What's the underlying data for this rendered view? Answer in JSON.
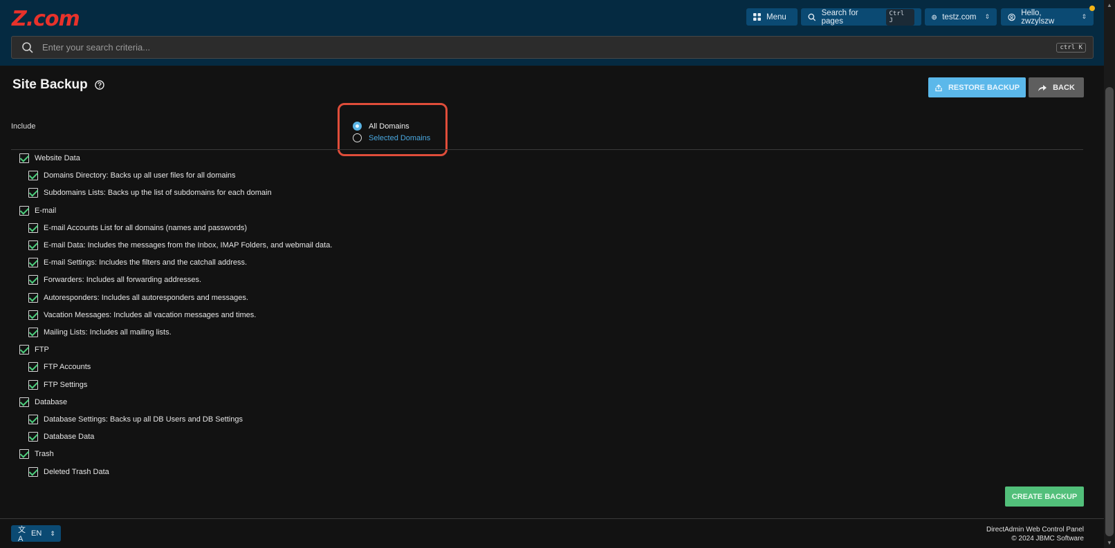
{
  "header": {
    "logo": "Z.com",
    "menu_label": "Menu",
    "search_pages_label": "Search for pages",
    "search_pages_shortcut": "Ctrl J",
    "domain_select": "testz.com",
    "user_label": "Hello, zwzylszw"
  },
  "search": {
    "placeholder": "Enter your search criteria...",
    "shortcut": "ctrl K"
  },
  "page": {
    "title": "Site Backup",
    "restore_button": "RESTORE BACKUP",
    "back_button": "BACK",
    "include_label": "Include",
    "domain_options": [
      {
        "label": "All Domains",
        "selected": true
      },
      {
        "label": "Selected Domains",
        "selected": false
      }
    ],
    "create_button": "CREATE BACKUP"
  },
  "backup_items": [
    {
      "label": "Website Data",
      "checked": true,
      "level": 0
    },
    {
      "label": "Domains Directory: Backs up all user files for all domains",
      "checked": true,
      "level": 1
    },
    {
      "label": "Subdomains Lists: Backs up the list of subdomains for each domain",
      "checked": true,
      "level": 1
    },
    {
      "label": "E-mail",
      "checked": true,
      "level": 0
    },
    {
      "label": "E-mail Accounts List for all domains (names and passwords)",
      "checked": true,
      "level": 1
    },
    {
      "label": "E-mail Data: Includes the messages from the Inbox, IMAP Folders, and webmail data.",
      "checked": true,
      "level": 1
    },
    {
      "label": "E-mail Settings: Includes the filters and the catchall address.",
      "checked": true,
      "level": 1
    },
    {
      "label": "Forwarders: Includes all forwarding addresses.",
      "checked": true,
      "level": 1
    },
    {
      "label": "Autoresponders: Includes all autoresponders and messages.",
      "checked": true,
      "level": 1
    },
    {
      "label": "Vacation Messages: Includes all vacation messages and times.",
      "checked": true,
      "level": 1
    },
    {
      "label": "Mailing Lists: Includes all mailing lists.",
      "checked": true,
      "level": 1
    },
    {
      "label": "FTP",
      "checked": true,
      "level": 0
    },
    {
      "label": "FTP Accounts",
      "checked": true,
      "level": 1
    },
    {
      "label": "FTP Settings",
      "checked": true,
      "level": 1
    },
    {
      "label": "Database",
      "checked": true,
      "level": 0
    },
    {
      "label": "Database Settings: Backs up all DB Users and DB Settings",
      "checked": true,
      "level": 1
    },
    {
      "label": "Database Data",
      "checked": true,
      "level": 1
    },
    {
      "label": "Trash",
      "checked": true,
      "level": 0
    },
    {
      "label": "Deleted Trash Data",
      "checked": true,
      "level": 1
    }
  ],
  "footer": {
    "language": "EN",
    "product": "DirectAdmin Web Control Panel",
    "copyright": "© 2024 JBMC Software"
  },
  "colors": {
    "header_bg": "#052a41",
    "accent_blue": "#5bb8ea",
    "accent_green": "#52bf7a",
    "logo_red": "#e8322b",
    "highlight_red": "#e04d3a"
  }
}
